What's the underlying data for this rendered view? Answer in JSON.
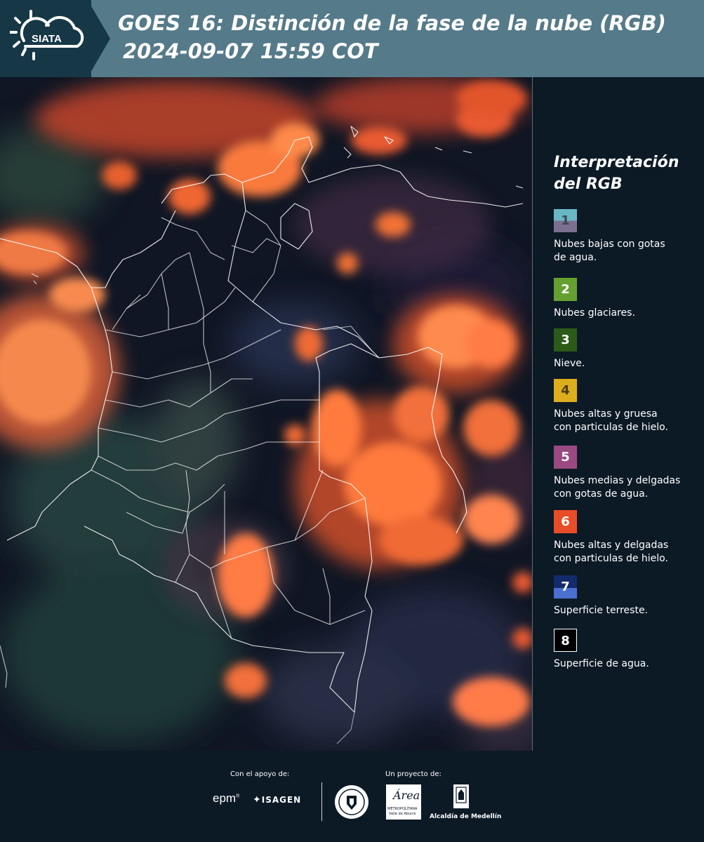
{
  "header": {
    "logo_text": "SIATA",
    "title_line1": "GOES 16: Distinción de la fase de la nube (RGB)",
    "title_line2": "2024-09-07 15:59 COT"
  },
  "legend": {
    "title_line1": "Interpretación",
    "title_line2": "del RGB",
    "items": [
      {
        "number": "1",
        "line1": "Nubes bajas con gotas",
        "line2": "de agua.",
        "color_top": "#6ab7c4",
        "color_bottom": "#7c708f",
        "text_color": "#3e4654"
      },
      {
        "number": "2",
        "line1": "Nubes glaciares.",
        "line2": "",
        "color_top": "#66a030",
        "color_bottom": "#66a030",
        "text_color": "#ffffff"
      },
      {
        "number": "3",
        "line1": "Nieve.",
        "line2": "",
        "color_top": "#2c5a18",
        "color_bottom": "#2c5a18",
        "text_color": "#ffffff"
      },
      {
        "number": "4",
        "line1": "Nubes altas y gruesa",
        "line2": "con particulas de hielo.",
        "color_top": "#dcae1d",
        "color_bottom": "#dcae1d",
        "text_color": "#4a3a10"
      },
      {
        "number": "5",
        "line1": "Nubes medias y delgadas",
        "line2": "con gotas de agua.",
        "color_top": "#9a4a80",
        "color_bottom": "#9a4a80",
        "text_color": "#ffffff"
      },
      {
        "number": "6",
        "line1": "Nubes altas y delgadas",
        "line2": "con particulas de hielo.",
        "color_top": "#e84d27",
        "color_bottom": "#e84d27",
        "text_color": "#ffffff"
      },
      {
        "number": "7",
        "line1": "Superficie terreste.",
        "line2": "",
        "color_top": "#142a6b",
        "color_bottom": "#4a6fd0",
        "text_color": "#ffffff"
      },
      {
        "number": "8",
        "line1": "Superficie de agua.",
        "line2": "",
        "color_top": "#000000",
        "color_bottom": "#000000",
        "text_color": "#ffffff"
      }
    ]
  },
  "footer": {
    "support_label": "Con el apoyo de:",
    "project_label": "Un proyecto de:",
    "epm_logo": "epm",
    "isagen_logo": "ISAGEN",
    "area_logo_script": "Área",
    "area_logo_line1": "METROPOLITANA",
    "area_logo_line2": "Valle de Aburrá",
    "alcaldia_logo": "Alcaldía de Medellín"
  },
  "colors": {
    "header_bg": "#557a89",
    "logo_bg": "#163746",
    "page_bg": "#0c1a26",
    "cloud_orange": "#f26a2e",
    "map_dark": "#121828"
  }
}
